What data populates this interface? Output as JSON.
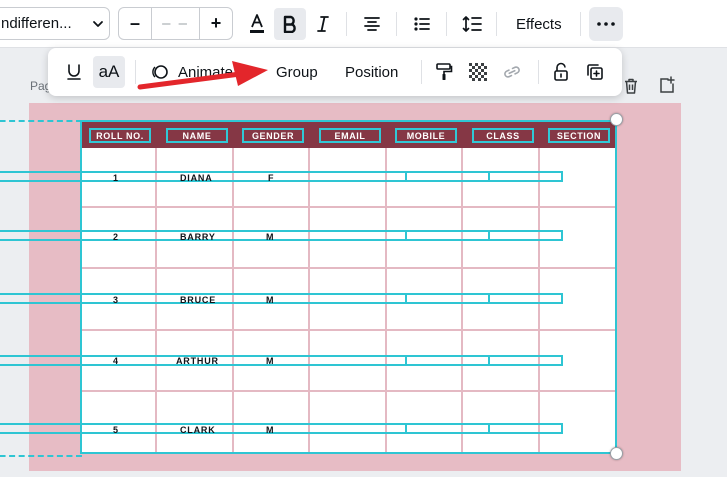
{
  "toolbar": {
    "font_name": "ndifferen...",
    "size_value": "– –",
    "decrease_label": "–",
    "increase_label": "+",
    "effects_label": "Effects"
  },
  "floating_toolbar": {
    "case_label": "aA",
    "animate_label": "Animate",
    "group_label": "Group",
    "position_label": "Position"
  },
  "page": {
    "label": "Pag"
  },
  "table": {
    "headers": [
      "ROLL NO.",
      "NAME",
      "GENDER",
      "EMAIL",
      "MOBILE",
      "CLASS",
      "SECTION"
    ],
    "rows": [
      {
        "roll": "1",
        "name": "DIANA",
        "gender": "F"
      },
      {
        "roll": "2",
        "name": "BARRY",
        "gender": "M"
      },
      {
        "roll": "3",
        "name": "BRUCE",
        "gender": "M"
      },
      {
        "roll": "4",
        "name": "ARTHUR",
        "gender": "M"
      },
      {
        "roll": "5",
        "name": "CLARK",
        "gender": "M"
      }
    ]
  },
  "colors": {
    "accent": "#2ec5d3",
    "table_header": "#853745",
    "page_background": "#e7bcc5",
    "annotation_arrow": "#e3262b"
  }
}
